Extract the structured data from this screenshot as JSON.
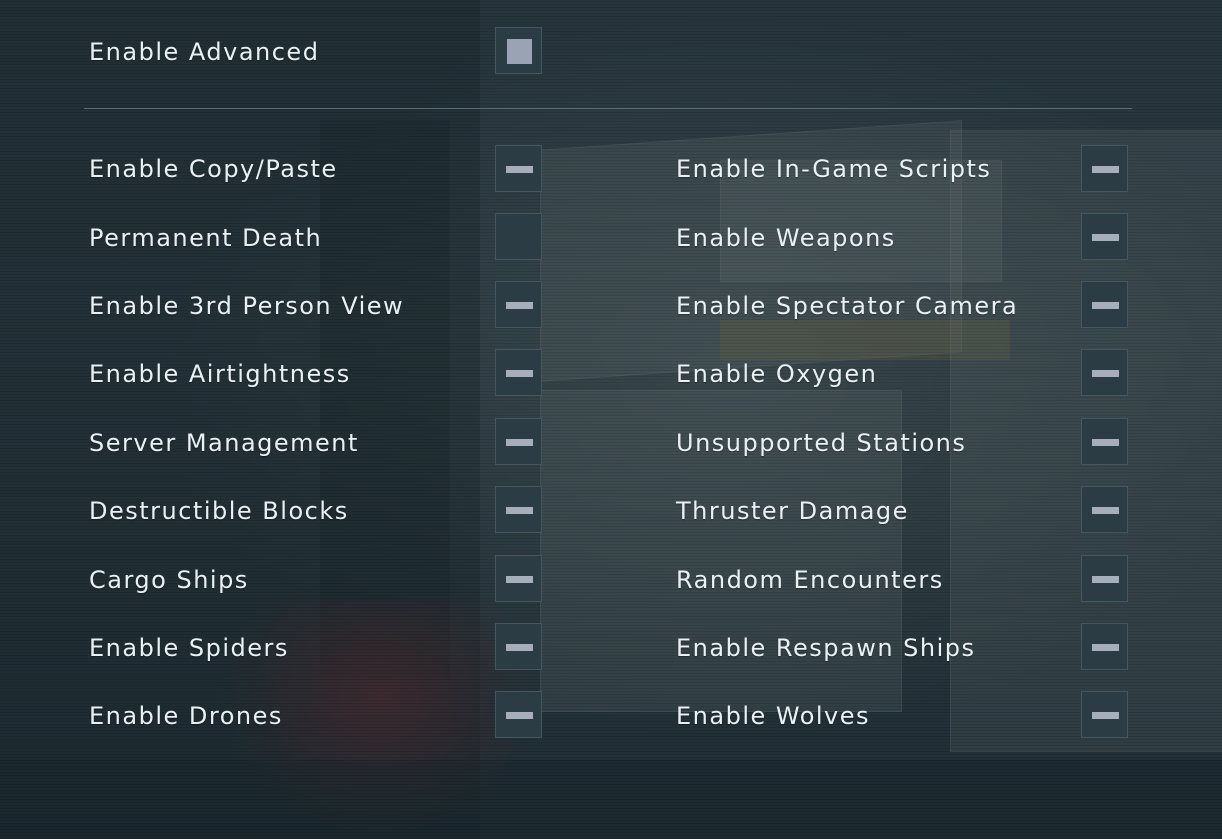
{
  "advanced": {
    "label": "Enable Advanced",
    "state": "square"
  },
  "left_column": [
    {
      "label": "Enable Copy/Paste",
      "state": "dash"
    },
    {
      "label": "Permanent Death",
      "state": "empty"
    },
    {
      "label": "Enable 3rd Person View",
      "state": "dash"
    },
    {
      "label": "Enable Airtightness",
      "state": "dash"
    },
    {
      "label": "Server Management",
      "state": "dash"
    },
    {
      "label": "Destructible Blocks",
      "state": "dash"
    },
    {
      "label": "Cargo Ships",
      "state": "dash"
    },
    {
      "label": "Enable Spiders",
      "state": "dash"
    },
    {
      "label": "Enable Drones",
      "state": "dash"
    }
  ],
  "right_column": [
    {
      "label": "Enable In-Game Scripts",
      "state": "dash"
    },
    {
      "label": "Enable Weapons",
      "state": "dash"
    },
    {
      "label": "Enable Spectator Camera",
      "state": "dash"
    },
    {
      "label": "Enable Oxygen",
      "state": "dash"
    },
    {
      "label": "Unsupported Stations",
      "state": "dash"
    },
    {
      "label": "Thruster Damage",
      "state": "dash"
    },
    {
      "label": "Random Encounters",
      "state": "dash"
    },
    {
      "label": "Enable Respawn Ships",
      "state": "dash"
    },
    {
      "label": "Enable Wolves",
      "state": "dash"
    }
  ],
  "colors": {
    "text": "#e9f1f5",
    "toggle_bg": "#2c3c45",
    "toggle_border": "#44565f",
    "toggle_mark": "#a6aebb"
  }
}
